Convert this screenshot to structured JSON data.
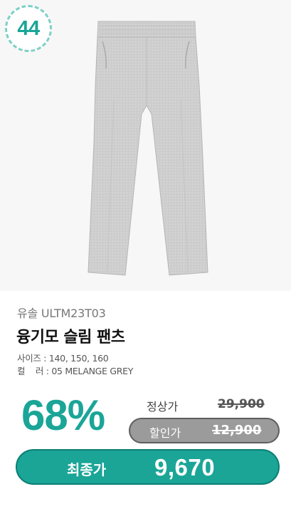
{
  "badge": {
    "number": "44"
  },
  "product": {
    "image_icon": "grey-sweatpants-illustration",
    "brand": "유솔 ULTM23T03",
    "name": "융기모 슬림 팬츠",
    "size_line": "사이즈 : 140, 150, 160",
    "color_line": "컬    러 : 05 MELANGE GREY"
  },
  "pricing": {
    "discount": "68%",
    "regular_label": "정상가",
    "regular_price": "29,900",
    "sale_label": "할인가",
    "sale_price": "12,900",
    "final_label": "최종가",
    "final_price": "9,670"
  },
  "colors": {
    "accent": "#1aa597",
    "badge_border": "#7ed0c6",
    "sale_pill": "#9b9b9b",
    "pants": "#cfcfcf"
  }
}
